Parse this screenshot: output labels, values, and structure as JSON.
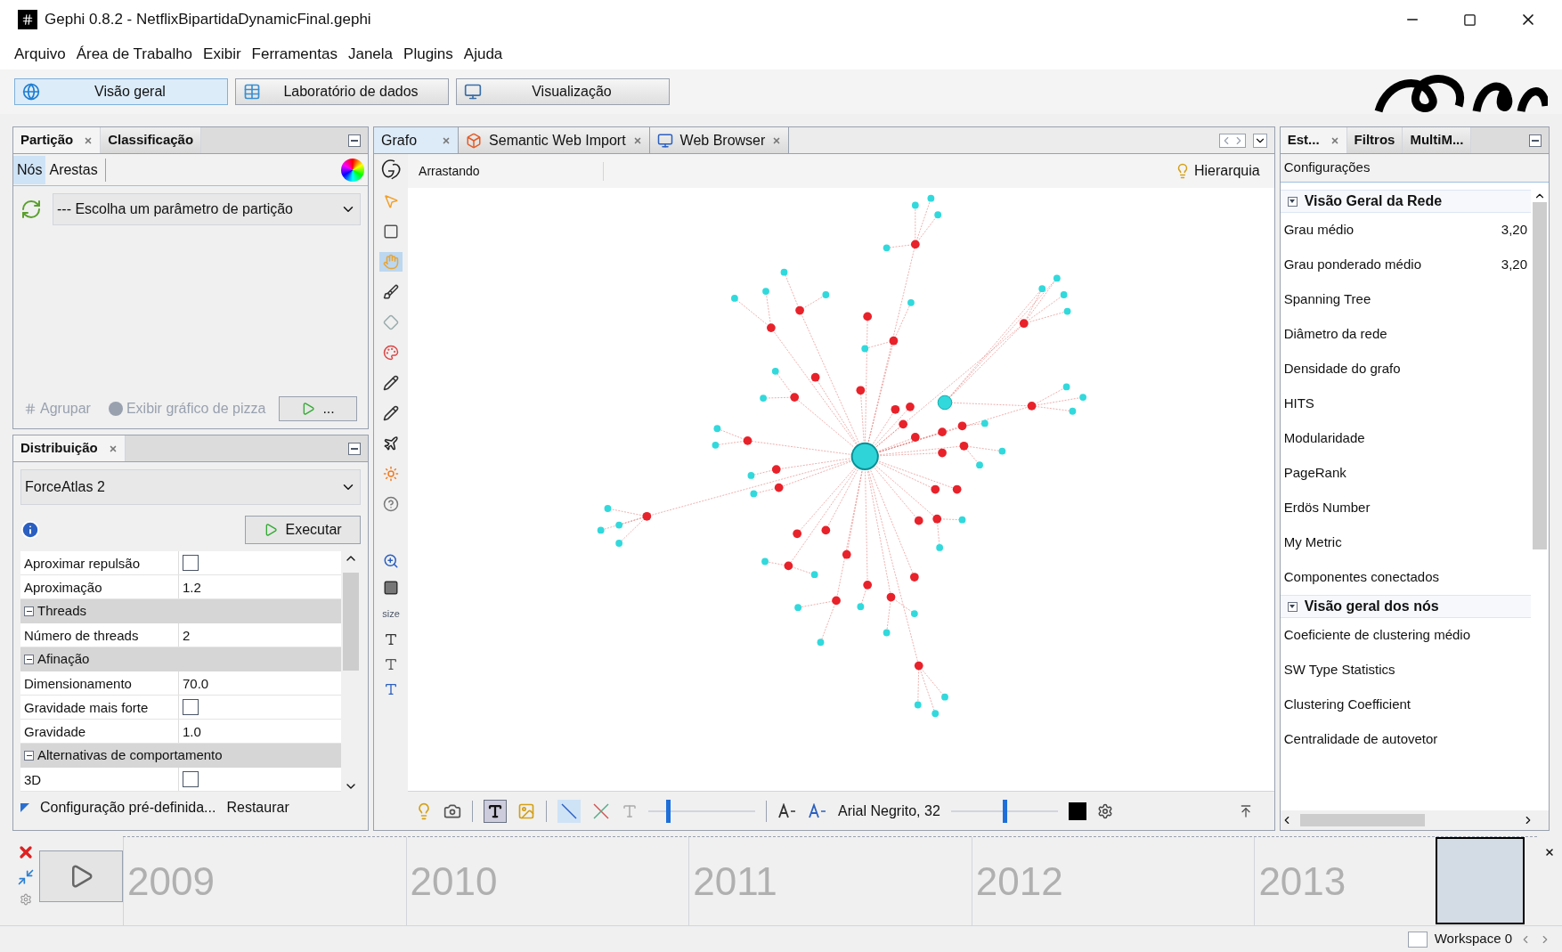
{
  "window": {
    "title": "Gephi 0.8.2 - NetflixBipartidaDynamicFinal.gephi"
  },
  "menu": [
    "Arquivo",
    "Área de Trabalho",
    "Exibir",
    "Ferramentas",
    "Janela",
    "Plugins",
    "Ajuda"
  ],
  "workspace_tabs": [
    {
      "label": "Visão geral",
      "kind": "globe",
      "selected": true
    },
    {
      "label": "Laboratório de dados",
      "kind": "table",
      "selected": false
    },
    {
      "label": "Visualização",
      "kind": "monitor",
      "selected": false
    }
  ],
  "partition_panel": {
    "tabs": [
      {
        "label": "Partição",
        "selected": true
      },
      {
        "label": "Classificação",
        "selected": false
      }
    ],
    "subtabs": [
      {
        "label": "Nós",
        "selected": true
      },
      {
        "label": "Arestas",
        "selected": false
      }
    ],
    "dropdown": "--- Escolha um parâmetro de partição",
    "group_button": {
      "label": "Agrupar",
      "disabled": true
    },
    "pie_button": {
      "label": "Exibir gráfico de pizza",
      "disabled": true
    },
    "apply_button": "..."
  },
  "layout_panel": {
    "title": "Distribuição",
    "dropdown": "ForceAtlas 2",
    "run_button": "Executar",
    "properties": [
      {
        "kind": "checkbox",
        "label": "Aproximar repulsão",
        "checked": false
      },
      {
        "kind": "text",
        "label": "Aproximação",
        "value": "1.2"
      },
      {
        "kind": "category",
        "label": "Threads",
        "expanded": true
      },
      {
        "kind": "text",
        "label": "Número de threads",
        "value": "2"
      },
      {
        "kind": "category",
        "label": "Afinação",
        "expanded": true
      },
      {
        "kind": "text",
        "label": "Dimensionamento",
        "value": "70.0"
      },
      {
        "kind": "checkbox",
        "label": "Gravidade mais forte",
        "checked": false
      },
      {
        "kind": "text",
        "label": "Gravidade",
        "value": "1.0"
      },
      {
        "kind": "category",
        "label": "Alternativas de comportamento",
        "expanded": true
      },
      {
        "kind": "checkbox",
        "label": "3D",
        "checked": false
      }
    ],
    "preset": "Configuração pré-definida...",
    "reset": "Restaurar"
  },
  "graph_panel": {
    "tabs": [
      {
        "label": "Grafo",
        "kind": "plain",
        "selected": true
      },
      {
        "label": "Semantic Web Import",
        "kind": "cube",
        "selected": false
      },
      {
        "label": "Web Browser",
        "kind": "browser",
        "selected": false
      }
    ],
    "mode": "Arrastando",
    "hierarchy_button": "Hierarquia",
    "tools": [
      {
        "kind": "pointer",
        "selected": false
      },
      {
        "kind": "rectangle",
        "selected": false
      },
      {
        "kind": "hand",
        "selected": true
      },
      {
        "kind": "brush",
        "selected": false
      },
      {
        "kind": "diamond",
        "selected": false
      },
      {
        "kind": "palette",
        "selected": false
      },
      {
        "kind": "pencil",
        "selected": false
      },
      {
        "kind": "pencil",
        "selected": false
      },
      {
        "kind": "plane",
        "selected": false
      },
      {
        "kind": "sun",
        "selected": false
      },
      {
        "kind": "help",
        "selected": false
      }
    ],
    "size_label": "size",
    "label_size_slider": {
      "level": 0.18
    },
    "font": "Arial Negrito, 32",
    "font_scale_slider": {
      "level": 0.5
    }
  },
  "statistics_panel": {
    "tabs": [
      {
        "label": "Est...",
        "selected": true
      },
      {
        "label": "Filtros",
        "selected": false
      },
      {
        "label": "MultiM...",
        "selected": false
      }
    ],
    "settings": "Configurações",
    "groups": [
      {
        "title": "Visão Geral da Rede",
        "expanded": true,
        "items": [
          {
            "label": "Grau médio",
            "value": "3,20"
          },
          {
            "label": "Grau ponderado médio",
            "value": "3,20"
          },
          {
            "label": "Spanning Tree"
          },
          {
            "label": "Diâmetro da rede"
          },
          {
            "label": "Densidade do grafo"
          },
          {
            "label": "HITS"
          },
          {
            "label": "Modularidade"
          },
          {
            "label": "PageRank"
          },
          {
            "label": "Erdös Number"
          },
          {
            "label": "My Metric"
          },
          {
            "label": "Componentes conectados"
          }
        ]
      },
      {
        "title": "Visão geral dos nós",
        "expanded": true,
        "items": [
          {
            "label": "Coeficiente de clustering médio"
          },
          {
            "label": "SW Type Statistics"
          },
          {
            "label": "Clustering Coefficient"
          },
          {
            "label": "Centralidade de autovetor"
          }
        ]
      }
    ]
  },
  "timeline": {
    "years": [
      "2009",
      "2010",
      "2011",
      "2012",
      "2013"
    ]
  },
  "status_bar": {
    "workspace": "Workspace 0"
  }
}
